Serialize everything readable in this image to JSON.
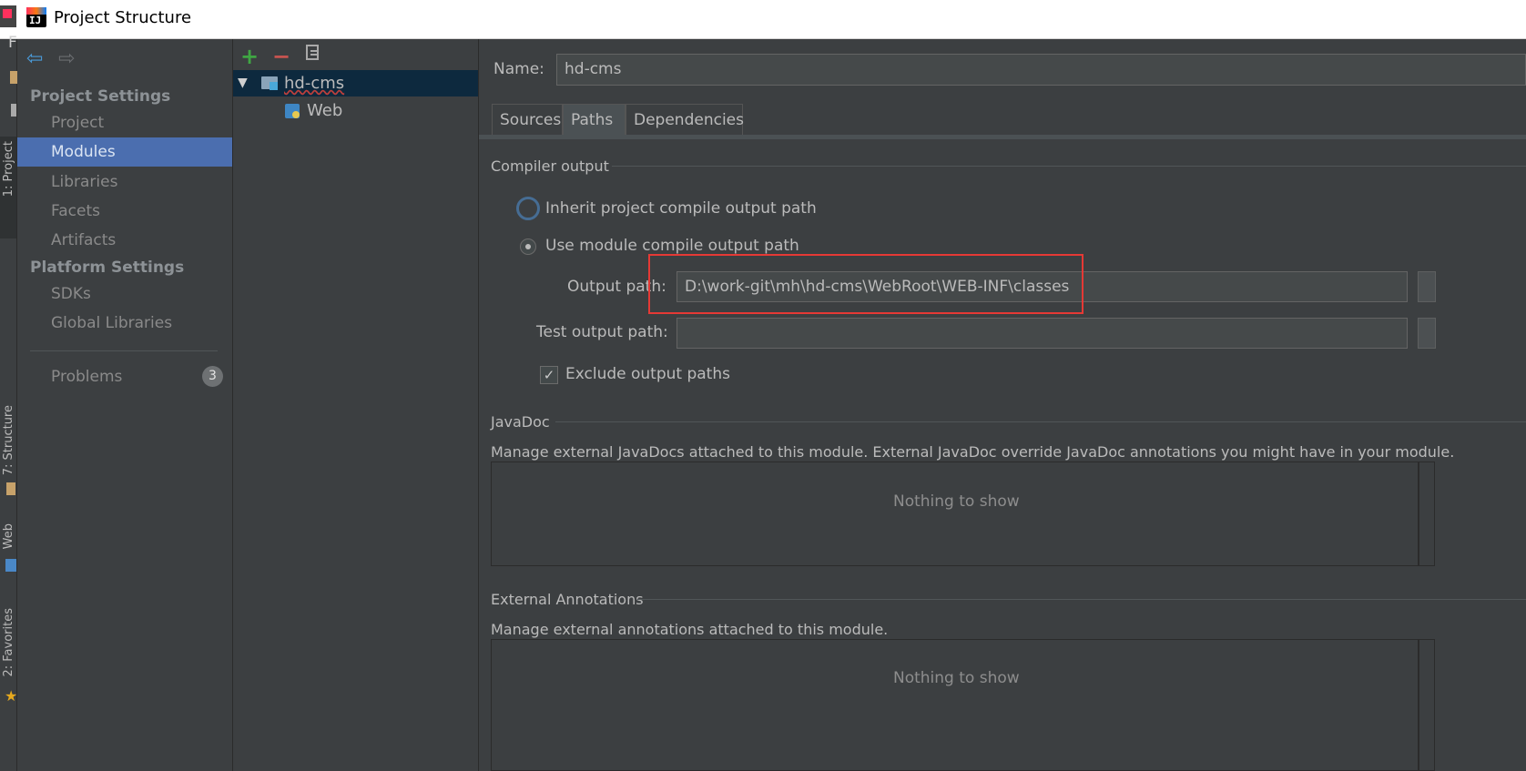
{
  "window": {
    "title": "Project Structure",
    "app_icon_text": "IJ"
  },
  "ide_strip": {
    "menu_letter": "F",
    "vertical_tabs": [
      "1: Project",
      "7: Structure",
      "Web",
      "2: Favorites"
    ]
  },
  "sidebar": {
    "back_icon": "back-arrow-icon",
    "forward_icon": "forward-arrow-icon",
    "project_settings_header": "Project Settings",
    "project_items": [
      {
        "label": "Project"
      },
      {
        "label": "Modules"
      },
      {
        "label": "Libraries"
      },
      {
        "label": "Facets"
      },
      {
        "label": "Artifacts"
      }
    ],
    "platform_settings_header": "Platform Settings",
    "platform_items": [
      {
        "label": "SDKs"
      },
      {
        "label": "Global Libraries"
      }
    ],
    "problems_label": "Problems",
    "problems_count": "3",
    "selected": "Modules"
  },
  "tree": {
    "toolbar": {
      "add": "+",
      "remove": "−"
    },
    "root": {
      "label": "hd-cms"
    },
    "children": [
      {
        "label": "Web"
      }
    ]
  },
  "module": {
    "name_label": "Name:",
    "name_value": "hd-cms",
    "tabs": [
      {
        "label": "Sources"
      },
      {
        "label": "Paths"
      },
      {
        "label": "Dependencies"
      }
    ],
    "selected_tab": "Paths",
    "compiler_output": {
      "title": "Compiler output",
      "inherit_label": "Inherit project compile output path",
      "use_module_label": "Use module compile output path",
      "output_path_label": "Output path:",
      "output_path_value": "D:\\work-git\\mh\\hd-cms\\WebRoot\\WEB-INF\\classes",
      "test_output_path_label": "Test output path:",
      "test_output_path_value": "",
      "exclude_label": "Exclude output paths",
      "exclude_checked": true
    },
    "javadoc": {
      "title": "JavaDoc",
      "description": "Manage external JavaDocs attached to this module. External JavaDoc override JavaDoc annotations you might have in your module.",
      "empty_text": "Nothing to show"
    },
    "external_annotations": {
      "title": "External Annotations",
      "description": "Manage external annotations attached to this module.",
      "empty_text": "Nothing to show"
    }
  },
  "colors": {
    "background": "#3c3f41",
    "selection": "#4b6eaf",
    "tree_selection": "#0d293e",
    "highlight": "#e53935",
    "add_green": "#3fa643",
    "remove_red": "#c75450"
  }
}
